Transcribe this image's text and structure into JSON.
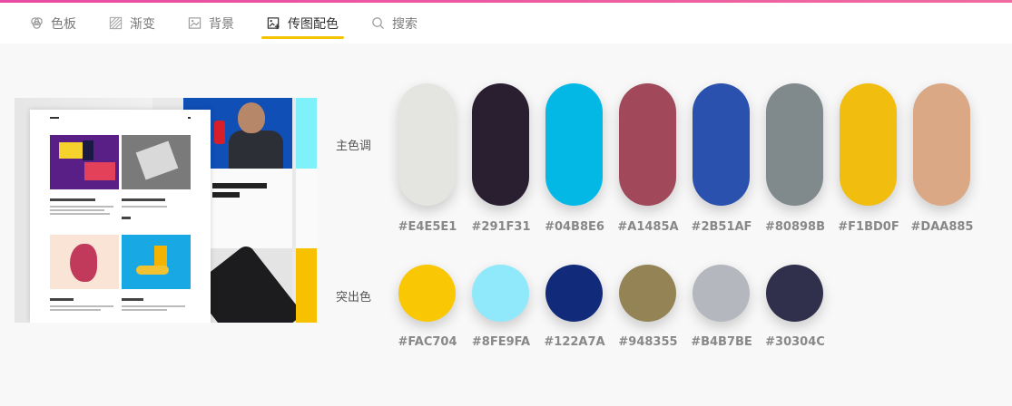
{
  "tabs": [
    {
      "label": "色板",
      "icon": "palette-icon"
    },
    {
      "label": "渐变",
      "icon": "gradient-icon"
    },
    {
      "label": "背景",
      "icon": "image-icon"
    },
    {
      "label": "传图配色",
      "icon": "upload-image-icon",
      "active": true
    },
    {
      "label": "搜索",
      "icon": "search-icon"
    }
  ],
  "accent": "#F5C400",
  "main": {
    "primary_label": "主色调",
    "highlight_label": "突出色",
    "primary_colors": [
      "#E4E5E1",
      "#291F31",
      "#04B8E6",
      "#A1485A",
      "#2B51AF",
      "#80898B",
      "#F1BD0F",
      "#DAA885"
    ],
    "highlight_colors": [
      "#FAC704",
      "#8FE9FA",
      "#122A7A",
      "#948355",
      "#B4B7BE",
      "#30304C"
    ]
  },
  "image_preview": {
    "card_heading": "Buttons",
    "card_subtitle": "VIP Full Pass",
    "snippets": [
      "Get your new Brand",
      "actor",
      "Just launc",
      "mobile-f"
    ]
  }
}
